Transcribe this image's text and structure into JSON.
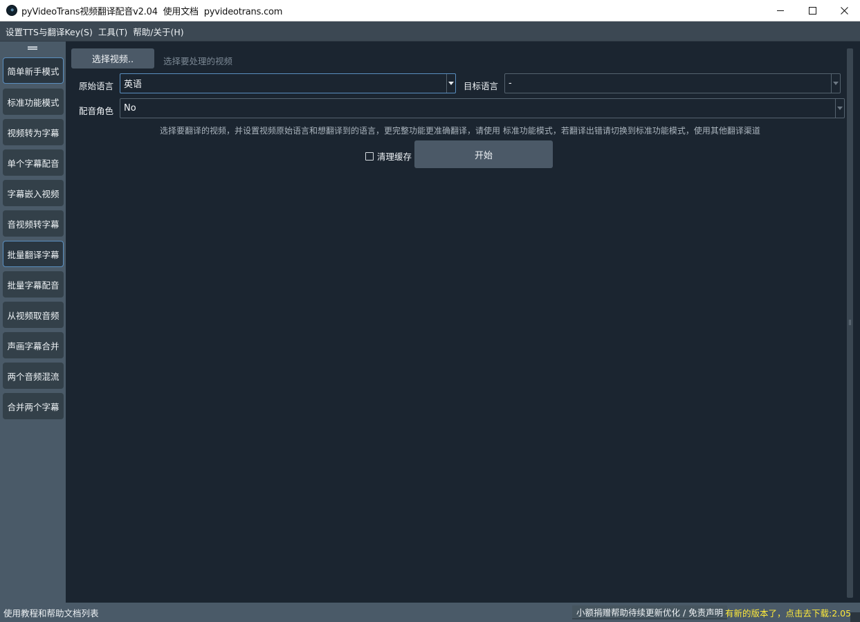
{
  "window": {
    "title": "pyVideoTrans视频翻译配音v2.04  使用文档  pyvideotrans.com",
    "icon": "app-logo-icon"
  },
  "menu": [
    "设置TTS与翻译Key(S)",
    "工具(T)",
    "帮助/关于(H)"
  ],
  "sidebar": {
    "items": [
      {
        "label": "简单新手模式",
        "active": true
      },
      {
        "label": "标准功能模式",
        "active": false
      },
      {
        "label": "视频转为字幕",
        "active": false
      },
      {
        "label": "单个字幕配音",
        "active": false
      },
      {
        "label": "字幕嵌入视频",
        "active": false
      },
      {
        "label": "音视频转字幕",
        "active": false
      },
      {
        "label": "批量翻译字幕",
        "active": true
      },
      {
        "label": "批量字幕配音",
        "active": false
      },
      {
        "label": "从视频取音频",
        "active": false
      },
      {
        "label": "声画字幕合并",
        "active": false
      },
      {
        "label": "两个音频混流",
        "active": false
      },
      {
        "label": "合并两个字幕",
        "active": false
      }
    ]
  },
  "main": {
    "select_video_label": "选择视频..",
    "select_video_hint": "选择要处理的视频",
    "source_language_label": "原始语言",
    "source_language_value": "英语",
    "target_language_label": "目标语言",
    "target_language_value": "-",
    "voice_role_label": "配音角色",
    "voice_role_value": "No",
    "tip": "选择要翻译的视频，并设置视频原始语言和想翻译到的语言，更完整功能更准确翻译，请使用 标准功能模式，若翻译出错请切换到标准功能模式，使用其他翻译渠道",
    "clean_cache_label": "清理缓存",
    "clean_cache_checked": false,
    "start_label": "开始"
  },
  "statusbar": {
    "help_docs": "使用教程和帮助文档列表",
    "donate": "小额捐赠帮助待续更新优化 / 免责声明",
    "update_notice": "有新的版本了，点击去下载:2.05"
  },
  "colors": {
    "background": "#1b2530",
    "panel": "#4a5a68",
    "button": "#4b5967",
    "accent_border": "#5a8fc0",
    "update_text": "#ffeb3b"
  }
}
